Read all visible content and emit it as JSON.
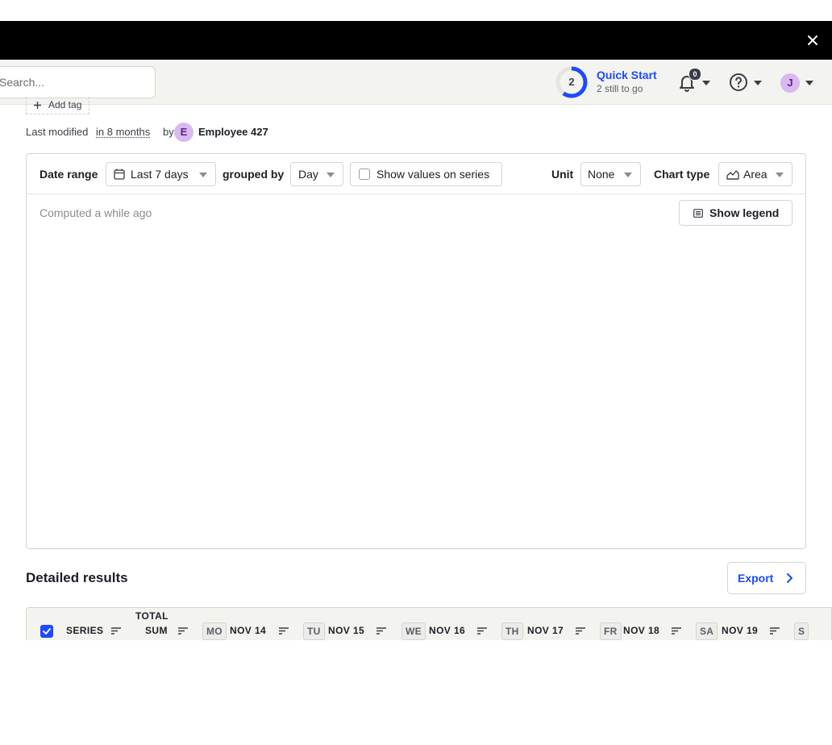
{
  "topbar": {
    "search_placeholder": "Search...",
    "quick_start": {
      "title": "Quick Start",
      "count": "2",
      "subtitle": "2 still to go",
      "progress": 0.6
    },
    "notifications_count": "0",
    "user_initial": "J"
  },
  "insight": {
    "add_tag": "Add tag",
    "last_modified_label": "Last modified",
    "last_modified_relative": "in 8 months",
    "by_label": "by",
    "author_initial": "E",
    "author_name": "Employee 427"
  },
  "chart_controls": {
    "date_range_label": "Date range",
    "date_range_value": "Last 7 days",
    "grouped_by_label": "grouped by",
    "grouped_by_value": "Day",
    "show_values_label": "Show values on series",
    "show_values_checked": false,
    "unit_label": "Unit",
    "unit_value": "None",
    "chart_type_label": "Chart type",
    "chart_type_value": "Area",
    "computed_text": "Computed a while ago",
    "show_legend_label": "Show legend"
  },
  "results": {
    "heading": "Detailed results",
    "export_label": "Export",
    "columns": {
      "series": "SERIES",
      "total_line1": "TOTAL",
      "total_line2": "SUM",
      "days": [
        {
          "dow": "MO",
          "date": "NOV 14"
        },
        {
          "dow": "TU",
          "date": "NOV 15"
        },
        {
          "dow": "WE",
          "date": "NOV 16"
        },
        {
          "dow": "TH",
          "date": "NOV 17"
        },
        {
          "dow": "FR",
          "date": "NOV 18"
        },
        {
          "dow": "SA",
          "date": "NOV 19"
        },
        {
          "dow": "S",
          "date": ""
        }
      ]
    }
  },
  "colors": {
    "accent": "#1d4aff",
    "banner": "#000000",
    "avatar_bg": "#dab8f0"
  }
}
